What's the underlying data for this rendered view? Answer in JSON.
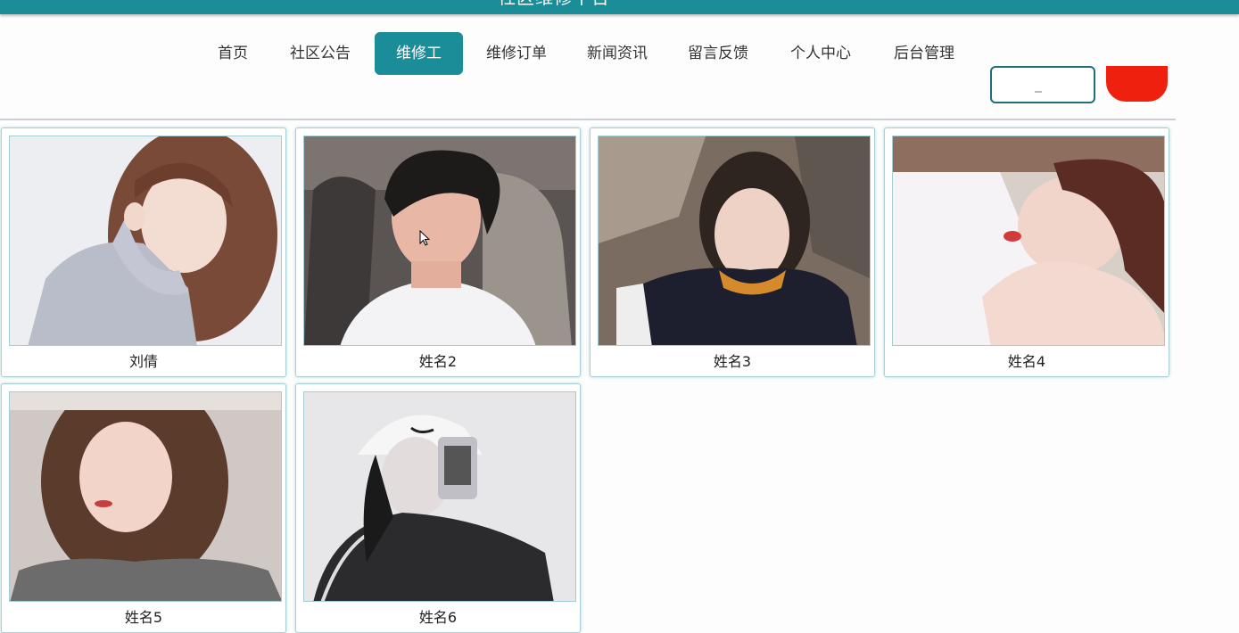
{
  "header": {
    "site_title": "社区维修平台"
  },
  "nav": {
    "items": [
      {
        "label": "首页",
        "active": false
      },
      {
        "label": "社区公告",
        "active": false
      },
      {
        "label": "维修工",
        "active": true
      },
      {
        "label": "维修订单",
        "active": false
      },
      {
        "label": "新闻资讯",
        "active": false
      },
      {
        "label": "留言反馈",
        "active": false
      },
      {
        "label": "个人中心",
        "active": false
      },
      {
        "label": "后台管理",
        "active": false
      }
    ]
  },
  "search": {
    "placeholder": "",
    "button_label": ""
  },
  "workers": [
    {
      "name": "刘倩",
      "photo": "portrait-woman-gray-sweater"
    },
    {
      "name": "姓名2",
      "photo": "portrait-man-car-seat"
    },
    {
      "name": "姓名3",
      "photo": "portrait-woman-rocks"
    },
    {
      "name": "姓名4",
      "photo": "portrait-woman-lying"
    },
    {
      "name": "姓名5",
      "photo": "portrait-woman-knit"
    },
    {
      "name": "姓名6",
      "photo": "portrait-woman-cap-phone"
    }
  ],
  "colors": {
    "accent": "#1b8d98",
    "danger": "#f0200f"
  }
}
